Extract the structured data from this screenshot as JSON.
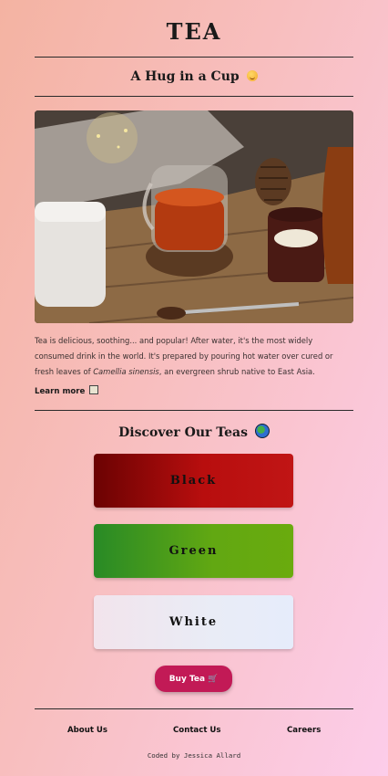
{
  "header": {
    "title": "TEA",
    "subtitle": "A Hug in a Cup"
  },
  "hero": {
    "icon": "tea-photo",
    "description_part1": "Tea is delicious, soothing... and popular! After water, it's the most widely consumed drink in the world. It's prepared by pouring hot water over cured or fresh leaves of ",
    "description_italic": "Camellia sinensis",
    "description_part2": ", an evergreen shrub native to East Asia.",
    "learn_more": "Learn more"
  },
  "discover": {
    "title": "Discover Our Teas",
    "teas": [
      {
        "label": "Black",
        "color": "#b80e0e"
      },
      {
        "label": "Green",
        "color": "#62a812"
      },
      {
        "label": "White",
        "color": "#e9ecf6"
      }
    ],
    "buy_label": "Buy Tea",
    "buy_color": "#c21a56"
  },
  "footer": {
    "links": [
      "About Us",
      "Contact Us",
      "Careers"
    ],
    "credit": "Coded by Jessica Allard"
  }
}
